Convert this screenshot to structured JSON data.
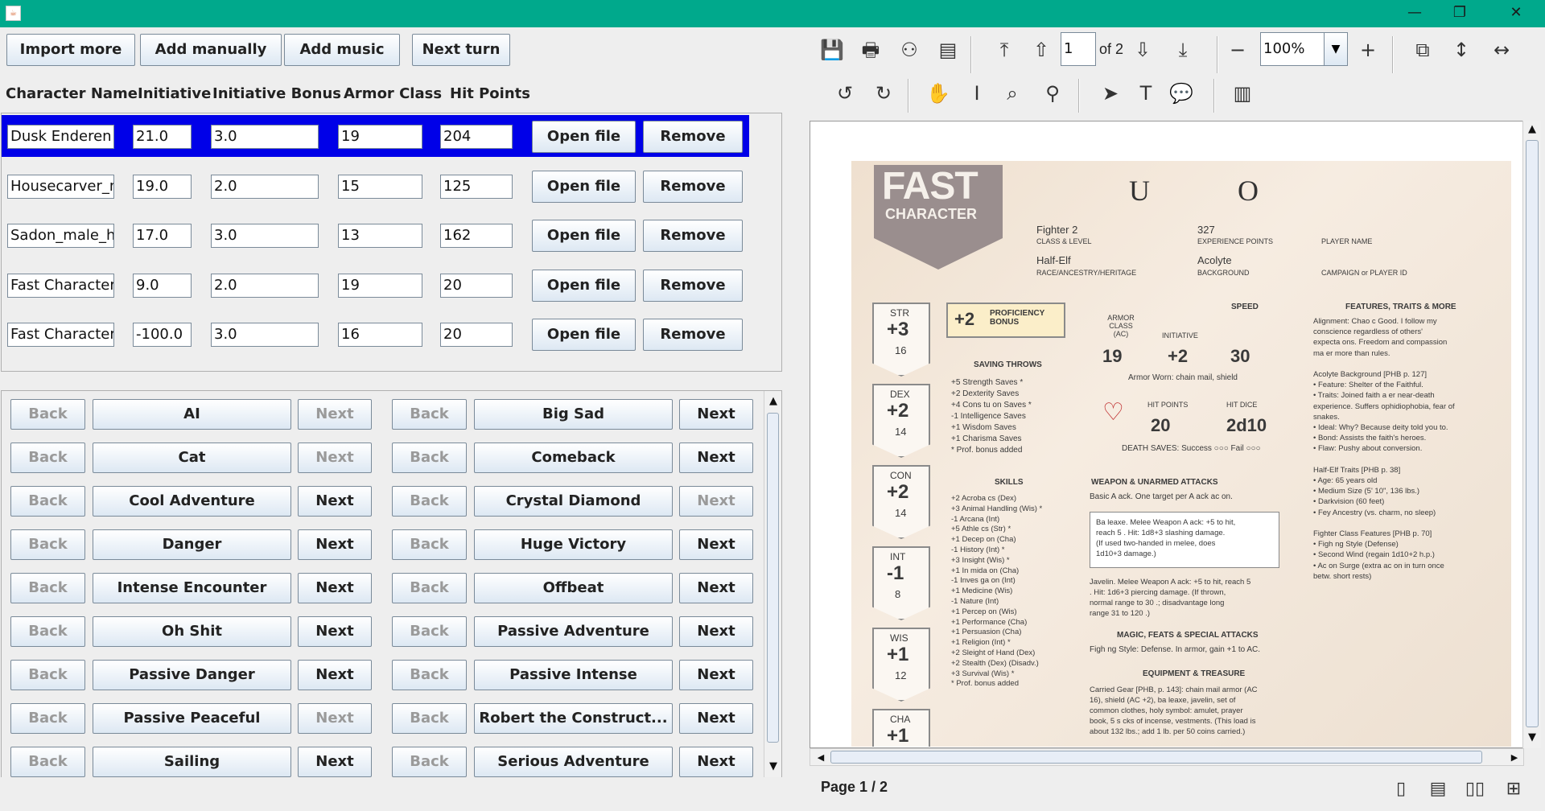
{
  "window": {
    "minimize": "—",
    "maximize": "❐",
    "close": "✕"
  },
  "top_buttons": [
    "Import more",
    "Add manually",
    "Add music",
    "Next turn"
  ],
  "columns": [
    "Character Name",
    "Initiative",
    "Initiative Bonus",
    "Armor Class",
    "Hit Points"
  ],
  "characters": [
    {
      "name": "Dusk Enderen -",
      "initiative": "21.0",
      "bonus": "3.0",
      "ac": "19",
      "hp": "204",
      "open": "Open file",
      "remove": "Remove",
      "selected": true
    },
    {
      "name": "Housecarver_m",
      "initiative": "19.0",
      "bonus": "2.0",
      "ac": "15",
      "hp": "125",
      "open": "Open file",
      "remove": "Remove"
    },
    {
      "name": "Sadon_male_hu",
      "initiative": "17.0",
      "bonus": "3.0",
      "ac": "13",
      "hp": "162",
      "open": "Open file",
      "remove": "Remove"
    },
    {
      "name": "Fast Character I",
      "initiative": "9.0",
      "bonus": "2.0",
      "ac": "19",
      "hp": "20",
      "open": "Open file",
      "remove": "Remove"
    },
    {
      "name": "Fast Character I",
      "initiative": "-100.0",
      "bonus": "3.0",
      "ac": "16",
      "hp": "20",
      "open": "Open file",
      "remove": "Remove"
    }
  ],
  "music": [
    {
      "back": "Back",
      "name": "AI",
      "next": "Next",
      "back_enabled": false,
      "next_enabled": false
    },
    {
      "back": "Back",
      "name": "Big Sad",
      "next": "Next",
      "back_enabled": false,
      "next_enabled": true
    },
    {
      "back": "Back",
      "name": "Cat",
      "next": "Next",
      "back_enabled": false,
      "next_enabled": false
    },
    {
      "back": "Back",
      "name": "Comeback",
      "next": "Next",
      "back_enabled": false,
      "next_enabled": true
    },
    {
      "back": "Back",
      "name": "Cool Adventure",
      "next": "Next",
      "back_enabled": false,
      "next_enabled": true
    },
    {
      "back": "Back",
      "name": "Crystal Diamond",
      "next": "Next",
      "back_enabled": false,
      "next_enabled": false
    },
    {
      "back": "Back",
      "name": "Danger",
      "next": "Next",
      "back_enabled": false,
      "next_enabled": true
    },
    {
      "back": "Back",
      "name": "Huge Victory",
      "next": "Next",
      "back_enabled": false,
      "next_enabled": true
    },
    {
      "back": "Back",
      "name": "Intense Encounter",
      "next": "Next",
      "back_enabled": false,
      "next_enabled": true
    },
    {
      "back": "Back",
      "name": "Offbeat",
      "next": "Next",
      "back_enabled": false,
      "next_enabled": true
    },
    {
      "back": "Back",
      "name": "Oh Shit",
      "next": "Next",
      "back_enabled": false,
      "next_enabled": true
    },
    {
      "back": "Back",
      "name": "Passive Adventure",
      "next": "Next",
      "back_enabled": false,
      "next_enabled": true
    },
    {
      "back": "Back",
      "name": "Passive Danger",
      "next": "Next",
      "back_enabled": false,
      "next_enabled": true
    },
    {
      "back": "Back",
      "name": "Passive Intense",
      "next": "Next",
      "back_enabled": false,
      "next_enabled": true
    },
    {
      "back": "Back",
      "name": "Passive Peaceful",
      "next": "Next",
      "back_enabled": false,
      "next_enabled": false
    },
    {
      "back": "Back",
      "name": "Robert the Construct...",
      "next": "Next",
      "back_enabled": false,
      "next_enabled": true
    },
    {
      "back": "Back",
      "name": "Sailing",
      "next": "Next",
      "back_enabled": false,
      "next_enabled": true
    },
    {
      "back": "Back",
      "name": "Serious Adventure",
      "next": "Next",
      "back_enabled": false,
      "next_enabled": true
    }
  ],
  "viewer": {
    "page_input": "1",
    "page_of": "of 2",
    "zoom": "100%",
    "status": "Page 1 / 2",
    "icons": [
      "save-icon",
      "print-icon",
      "search-binoculars-icon",
      "document-properties-icon",
      "first-page-icon",
      "previous-page-icon",
      "next-page-icon",
      "last-page-icon",
      "zoom-out-icon",
      "zoom-in-icon",
      "actual-size-icon",
      "fit-height-icon",
      "fit-width-icon",
      "rotate-left-icon",
      "rotate-right-icon",
      "pan-hand-icon",
      "text-select-icon",
      "zoom-marquee-icon",
      "zoom-dynamic-icon",
      "pointer-icon",
      "text-annotation-icon",
      "comment-icon",
      "page-thumbnail-icon",
      "single-page-view-icon",
      "continuous-view-icon",
      "facing-pages-icon",
      "facing-continuous-icon"
    ]
  },
  "sheet": {
    "logo_line1": "FAST",
    "logo_line2": "CHARACTER",
    "name_glyphs": [
      "U",
      "O"
    ],
    "class_level": "Fighter 2",
    "class_level_label": "CLASS & LEVEL",
    "xp": "327",
    "xp_label": "EXPERIENCE POINTS",
    "player_name_label": "PLAYER NAME",
    "race": "Half-Elf",
    "race_label": "RACE/ANCESTRY/HERITAGE",
    "background": "Acolyte",
    "background_label": "BACKGROUND",
    "campaign_label": "CAMPAIGN or PLAYER ID",
    "abilities": [
      {
        "name": "STR",
        "mod": "+3",
        "score": "16"
      },
      {
        "name": "DEX",
        "mod": "+2",
        "score": "14"
      },
      {
        "name": "CON",
        "mod": "+2",
        "score": "14"
      },
      {
        "name": "INT",
        "mod": "-1",
        "score": "8"
      },
      {
        "name": "WIS",
        "mod": "+1",
        "score": "12"
      },
      {
        "name": "CHA",
        "mod": "+1",
        "score": ""
      }
    ],
    "prof_bonus": "+2",
    "prof_label": "PROFICIENCY BONUS",
    "ac": "19",
    "ac_label": "ARMOR CLASS (AC)",
    "initiative": "+2",
    "initiative_label": "INITIATIVE",
    "speed": "30",
    "speed_label": "SPEED",
    "armor_worn": "Armor Worn: chain mail, shield",
    "hp": "20",
    "hp_label": "HIT POINTS",
    "hit_dice": "2d10",
    "hit_dice_label": "HIT DICE",
    "death_saves": "DEATH SAVES:  Success ○○○  Fail ○○○",
    "saving_throws_title": "SAVING THROWS",
    "saving_throws": [
      "+5 Strength Saves *",
      "+2 Dexterity Saves",
      "+4 Cons  tu  on Saves *",
      "-1 Intelligence Saves",
      "+1 Wisdom Saves",
      "+1 Charisma Saves",
      "* Prof. bonus added"
    ],
    "skills_title": "SKILLS",
    "skills": [
      "+2 Acroba  cs (Dex)",
      "+3 Animal Handling (Wis) *",
      "-1 Arcana (Int)",
      "+5 Athle  cs (Str) *",
      "+1 Decep  on (Cha)",
      "-1 History (Int) *",
      "+3 Insight (Wis) *",
      "+1 In  mida  on (Cha)",
      "-1 Inves  ga  on (Int)",
      "+1 Medicine (Wis)",
      "-1 Nature (Int)",
      "+1 Percep  on (Wis)",
      "+1 Performance (Cha)",
      "+1 Persuasion (Cha)",
      "+1 Religion (Int) *",
      "+2 Sleight of Hand (Dex)",
      "+2 Stealth (Dex) (Disadv.)",
      "+3 Survival (Wis) *",
      "* Prof. bonus added"
    ],
    "attacks_title": "WEAPON & UNARMED ATTACKS",
    "attacks_basic": "Basic A  ack. One target per A  ack ac  on.",
    "attacks_box": [
      "Ba  leaxe. Melee Weapon A  ack: +5 to hit,",
      "reach 5  . Hit: 1d8+3 slashing damage.",
      "(If used two-handed in melee, does",
      "1d10+3 damage.)"
    ],
    "attacks_javelin": [
      "Javelin. Melee Weapon A  ack: +5 to hit, reach 5",
      "  . Hit: 1d6+3 piercing damage. (If thrown,",
      "normal range to 30  .; disadvantage long",
      "range 31 to 120  .)"
    ],
    "magic_title": "MAGIC, FEATS & SPECIAL ATTACKS",
    "magic_text": "Figh  ng Style: Defense. In armor, gain +1 to AC.",
    "equipment_title": "EQUIPMENT & TREASURE",
    "equipment_text": [
      "Carried Gear [PHB, p. 143]: chain mail armor (AC",
      "16), shield (AC +2), ba  leaxe, javelin, set of",
      "common clothes, holy symbol: amulet, prayer",
      "book, 5 s  cks of incense, vestments. (This load is",
      "about 132 lbs.; add 1 lb. per 50 coins carried.)"
    ],
    "features_title": "FEATURES, TRAITS & MORE",
    "features": [
      "Alignment: Chao  c Good. I follow my",
      "  conscience regardless of others'",
      "  expecta  ons. Freedom and compassion",
      "  ma  er more than rules.",
      "",
      "Acolyte Background [PHB p. 127]",
      "• Feature: Shelter of the Faithful.",
      "• Traits: Joined faith a  er near-death",
      "  experience. Suffers ophidiophobia, fear of",
      "  snakes.",
      "• Ideal: Why? Because deity told you to.",
      "• Bond: Assists the faith's heroes.",
      "• Flaw: Pushy about conversion.",
      "",
      "Half-Elf Traits [PHB p. 38]",
      "• Age: 65 years old",
      "• Medium Size (5' 10\", 136 lbs.)",
      "• Darkvision (60 feet)",
      "• Fey Ancestry (vs. charm, no sleep)",
      "",
      "Fighter Class Features [PHB p. 70]",
      "• Figh  ng Style (Defense)",
      "• Second Wind (regain 1d10+2 h.p.)",
      "• Ac  on Surge (extra ac  on in turn once",
      "  betw. short rests)"
    ]
  }
}
